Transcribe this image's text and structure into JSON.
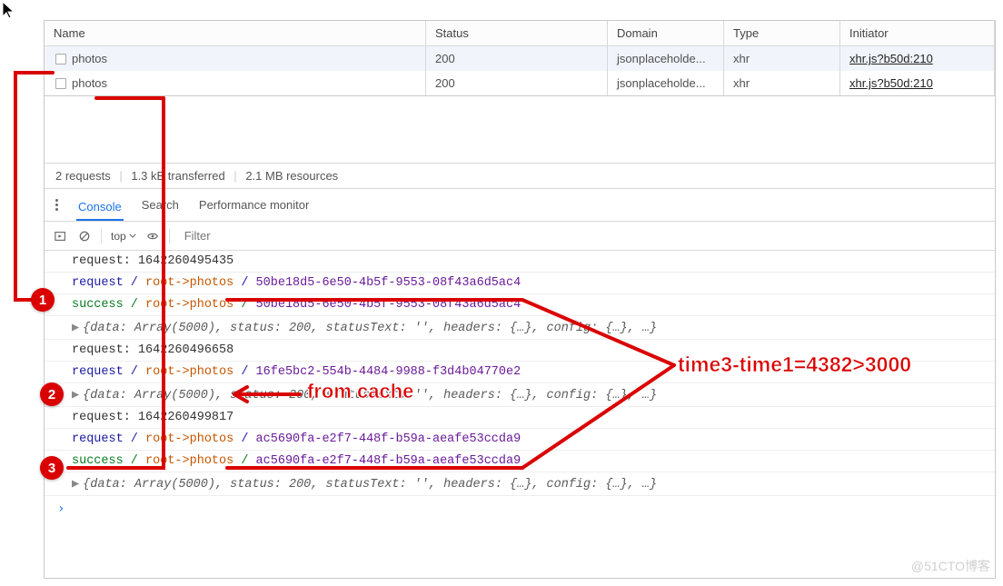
{
  "network": {
    "columns": [
      "Name",
      "Status",
      "Domain",
      "Type",
      "Initiator"
    ],
    "rows": [
      {
        "name": "photos",
        "status": "200",
        "domain": "jsonplaceholde...",
        "type": "xhr",
        "initiator": "xhr.js?b50d:210"
      },
      {
        "name": "photos",
        "status": "200",
        "domain": "jsonplaceholde...",
        "type": "xhr",
        "initiator": "xhr.js?b50d:210"
      }
    ],
    "summary": {
      "requests": "2 requests",
      "transferred": "1.3 kB transferred",
      "resources": "2.1 MB resources"
    }
  },
  "tabs": {
    "console": "Console",
    "search": "Search",
    "perf": "Performance monitor"
  },
  "filter": {
    "top": "top",
    "placeholder": "Filter"
  },
  "logs": {
    "obj_repr": "{data: Array(5000), status: 200, statusText: '', headers: {…}, config: {…}, …}",
    "r1_label": "request:",
    "r1_time": "1642260495435",
    "r1_req": {
      "pfx": "request / ",
      "path": "root->photos",
      "sep": " / ",
      "id": "50be18d5-6e50-4b5f-9553-08f43a6d5ac4"
    },
    "r1_suc": {
      "pfx": "success / ",
      "path": "root->photos",
      "sep": " / ",
      "id": "50be18d5-6e50-4b5f-9553-08f43a6d5ac4"
    },
    "r2_label": "request:",
    "r2_time": "1642260496658",
    "r2_req": {
      "pfx": "request / ",
      "path": "root->photos",
      "sep": " / ",
      "id": "16fe5bc2-554b-4484-9988-f3d4b04770e2"
    },
    "r3_label": "request:",
    "r3_time": "1642260499817",
    "r3_req": {
      "pfx": "request / ",
      "path": "root->photos",
      "sep": " / ",
      "id": "ac5690fa-e2f7-448f-b59a-aeafe53ccda9"
    },
    "r3_suc": {
      "pfx": "success / ",
      "path": "root->photos",
      "sep": " / ",
      "id": "ac5690fa-e2f7-448f-b59a-aeafe53ccda9"
    }
  },
  "annotations": {
    "badge1": "1",
    "badge2": "2",
    "badge3": "3",
    "from_cache": "from cache",
    "time_eq": "time3-time1=4382>3000"
  },
  "watermark": "@51CTO博客"
}
